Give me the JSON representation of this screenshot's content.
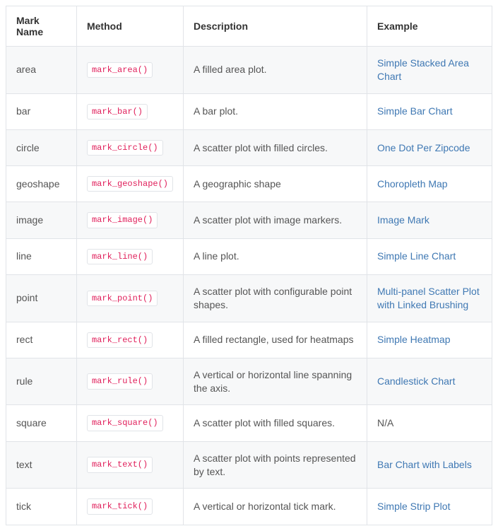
{
  "table": {
    "headers": {
      "mark_name": "Mark Name",
      "method": "Method",
      "description": "Description",
      "example": "Example"
    },
    "rows": [
      {
        "mark": "area",
        "method": "mark_area()",
        "description": "A filled area plot.",
        "example": "Simple Stacked Area Chart",
        "example_is_link": true
      },
      {
        "mark": "bar",
        "method": "mark_bar()",
        "description": "A bar plot.",
        "example": "Simple Bar Chart",
        "example_is_link": true
      },
      {
        "mark": "circle",
        "method": "mark_circle()",
        "description": "A scatter plot with filled circles.",
        "example": "One Dot Per Zipcode",
        "example_is_link": true
      },
      {
        "mark": "geoshape",
        "method": "mark_geoshape()",
        "description": "A geographic shape",
        "example": "Choropleth Map",
        "example_is_link": true
      },
      {
        "mark": "image",
        "method": "mark_image()",
        "description": "A scatter plot with image markers.",
        "example": "Image Mark",
        "example_is_link": true
      },
      {
        "mark": "line",
        "method": "mark_line()",
        "description": "A line plot.",
        "example": "Simple Line Chart",
        "example_is_link": true
      },
      {
        "mark": "point",
        "method": "mark_point()",
        "description": "A scatter plot with configurable point shapes.",
        "example": "Multi-panel Scatter Plot with Linked Brushing",
        "example_is_link": true
      },
      {
        "mark": "rect",
        "method": "mark_rect()",
        "description": "A filled rectangle, used for heatmaps",
        "example": "Simple Heatmap",
        "example_is_link": true
      },
      {
        "mark": "rule",
        "method": "mark_rule()",
        "description": "A vertical or horizontal line spanning the axis.",
        "example": "Candlestick Chart",
        "example_is_link": true
      },
      {
        "mark": "square",
        "method": "mark_square()",
        "description": "A scatter plot with filled squares.",
        "example": "N/A",
        "example_is_link": false
      },
      {
        "mark": "text",
        "method": "mark_text()",
        "description": "A scatter plot with points represented by text.",
        "example": "Bar Chart with Labels",
        "example_is_link": true
      },
      {
        "mark": "tick",
        "method": "mark_tick()",
        "description": "A vertical or horizontal tick mark.",
        "example": "Simple Strip Plot",
        "example_is_link": true
      }
    ]
  }
}
